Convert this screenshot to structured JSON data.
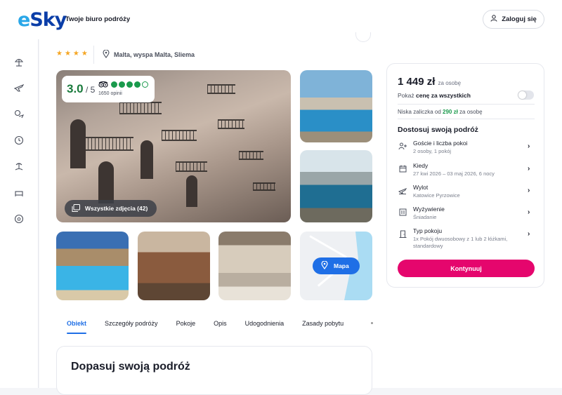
{
  "header": {
    "logo_e": "e",
    "logo_rest": "Sky",
    "tagline": "Twoje biuro podróży",
    "login_label": "Zaloguj się"
  },
  "sidebar": {
    "icons": [
      "beach-umbrella-icon",
      "plane-icon",
      "flights-hotel-icon",
      "last-minute-clock-icon",
      "island-icon",
      "hotel-bed-icon",
      "soccer-icon"
    ]
  },
  "hotel": {
    "stars": "★★★★",
    "location": "Malta, wyspa Malta, Sliema"
  },
  "rating": {
    "score": "3.0",
    "max": " / 5",
    "opinions": "1650 opinii",
    "filled_dots": 4,
    "total_dots": 5
  },
  "gallery": {
    "all_photos_label": "Wszystkie zdjęcia (42)",
    "map_label": "Mapa"
  },
  "tabs": [
    {
      "label": "Obiekt"
    },
    {
      "label": "Szczegóły podróży"
    },
    {
      "label": "Pokoje"
    },
    {
      "label": "Opis"
    },
    {
      "label": "Udogodnienia"
    },
    {
      "label": "Zasady pobytu"
    }
  ],
  "adapt_section": {
    "title": "Dopasuj swoją podróż"
  },
  "booking": {
    "price": "1 449 zł",
    "price_per": "za osobę",
    "show_prefix": "Pokaż ",
    "show_bold": "cenę za wszystkich",
    "deposit_prefix": "Niska zaliczka od ",
    "deposit_amount": "290 zł",
    "deposit_suffix": " za osobę",
    "customize_title": "Dostosuj swoją podróż",
    "options": [
      {
        "label": "Goście i liczba pokoi",
        "value": "2 osoby, 1 pokój",
        "icon": "guests-icon"
      },
      {
        "label": "Kiedy",
        "value": "27 kwi 2026 – 03 maj 2026, 6 nocy",
        "icon": "calendar-icon"
      },
      {
        "label": "Wylot",
        "value": "Katowice Pyrzowice",
        "icon": "departure-plane-icon"
      },
      {
        "label": "Wyżywienie",
        "value": "Śniadanie",
        "icon": "meals-icon"
      },
      {
        "label": "Typ pokoju",
        "value": "1x Pokój dwuosobowy z 1 lub 2 łóżkami, standardowy",
        "icon": "room-door-icon"
      }
    ],
    "continue_label": "Kontynuuj"
  },
  "colors": {
    "brand_pink": "#e5066d",
    "link_blue": "#1f6fe6",
    "rating_green": "#1a9a4c",
    "star_gold": "#f5a623"
  }
}
